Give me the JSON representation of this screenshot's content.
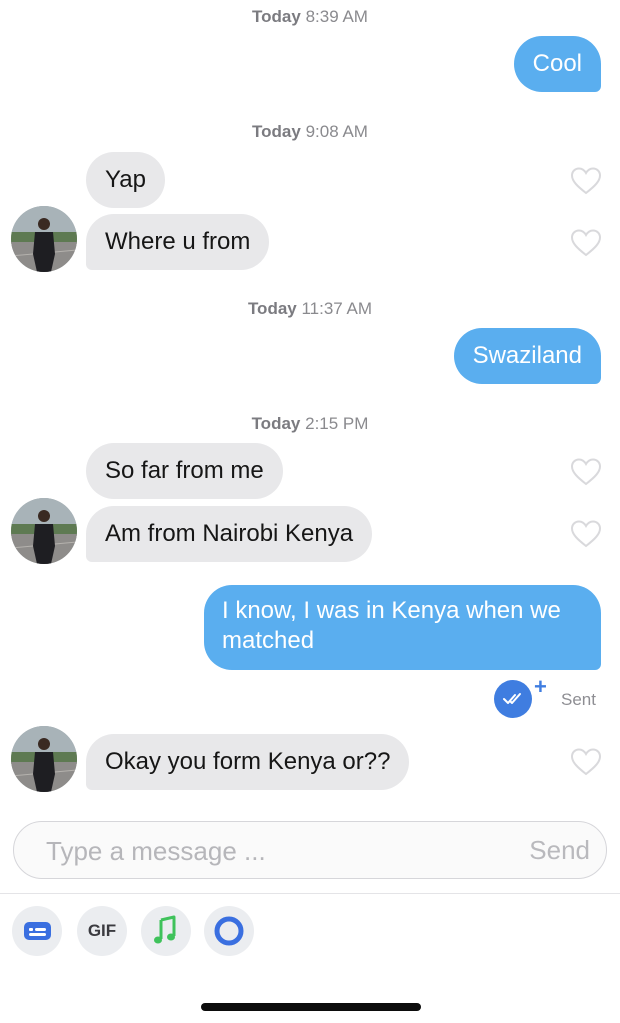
{
  "messages": {
    "ts1": {
      "day": "Today",
      "time": "8:39 AM"
    },
    "m1": "Cool",
    "ts2": {
      "day": "Today",
      "time": "9:08 AM"
    },
    "m2": "Yap",
    "m3": "Where u from",
    "ts3": {
      "day": "Today",
      "time": "11:37 AM"
    },
    "m4": "Swaziland",
    "ts4": {
      "day": "Today",
      "time": "2:15 PM"
    },
    "m5": "So far from me",
    "m6": "Am from Nairobi Kenya",
    "m7_line1": "I know, I was in Kenya when we",
    "m7_line2": "matched",
    "status": "Sent",
    "m8": "Okay you form Kenya or??"
  },
  "composer": {
    "placeholder": "Type a message ...",
    "send_label": "Send"
  },
  "toolbar": {
    "gif_label": "GIF",
    "icons": [
      "sticker-icon",
      "gif-icon",
      "music-icon",
      "ring-icon"
    ]
  },
  "colors": {
    "outgoing": "#5aaeef",
    "incoming": "#e8e8ea",
    "read_receipt": "#3f7de0",
    "music": "#3fc25b",
    "ring": "#3a6fe0"
  }
}
